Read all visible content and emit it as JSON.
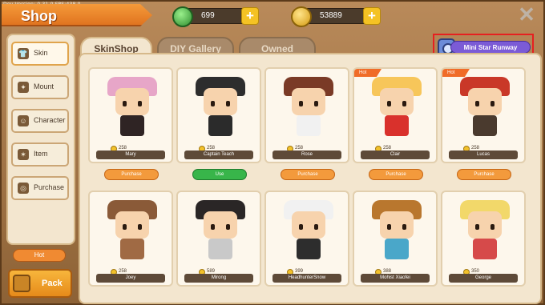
{
  "dev_info": "Dev Version: 0.31.0     FPS:438.0",
  "title": "Shop",
  "currency": [
    {
      "icon": "gem-icon",
      "value": "699"
    },
    {
      "icon": "coin-icon",
      "value": "53889"
    }
  ],
  "sidebar": {
    "items": [
      {
        "label": "Skin",
        "icon": "shirt-icon",
        "active": true
      },
      {
        "label": "Mount",
        "icon": "wings-icon"
      },
      {
        "label": "Character",
        "icon": "cat-icon"
      },
      {
        "label": "Item",
        "icon": "firework-icon"
      },
      {
        "label": "Purchase",
        "icon": "coins-icon"
      }
    ],
    "hot_label": "Hot",
    "pack_label": "Pack"
  },
  "tabs": [
    {
      "label": "SkinShop",
      "active": true
    },
    {
      "label": "DIY Gallery"
    },
    {
      "label": "Owned"
    }
  ],
  "runway_label": "Mini Star Runway",
  "cards": [
    {
      "name": "Mary",
      "price": "258",
      "action": "Purchase",
      "hot": false,
      "hair": "#e7a6c8",
      "outfit": "#2f2424"
    },
    {
      "name": "Captain Teach",
      "price": "258",
      "action": "Use",
      "hot": false,
      "hair": "#2d2d2d",
      "outfit": "#2b2b2b"
    },
    {
      "name": "Rose",
      "price": "258",
      "action": "Purchase",
      "hot": false,
      "hair": "#7a3a26",
      "outfit": "#f1f1f1"
    },
    {
      "name": "Clair",
      "price": "258",
      "action": "Purchase",
      "hot": true,
      "hair": "#f7c65a",
      "outfit": "#d9312c"
    },
    {
      "name": "Lucas",
      "price": "258",
      "action": "Purchase",
      "hot": true,
      "hair": "#c93828",
      "outfit": "#4a3a2e"
    },
    {
      "name": "Joey",
      "price": "258",
      "action": "",
      "hot": false,
      "hair": "#8a5a38",
      "outfit": "#a06a44"
    },
    {
      "name": "Mirong",
      "price": "589",
      "action": "",
      "hot": false,
      "hair": "#2a2626",
      "outfit": "#c9c9c9"
    },
    {
      "name": "HeadhunterSnow",
      "price": "399",
      "action": "",
      "hot": false,
      "hair": "#f1f1f1",
      "outfit": "#2d2d2d"
    },
    {
      "name": "Mohist Xiaofei",
      "price": "388",
      "action": "",
      "hot": false,
      "hair": "#b9772e",
      "outfit": "#4aa7c9"
    },
    {
      "name": "George",
      "price": "350",
      "action": "",
      "hot": false,
      "hair": "#f2d86a",
      "outfit": "#d64a4a"
    }
  ],
  "colors": {
    "accent": "#f39a3c",
    "use_green": "#38b54a",
    "highlight_red": "#e62020"
  }
}
